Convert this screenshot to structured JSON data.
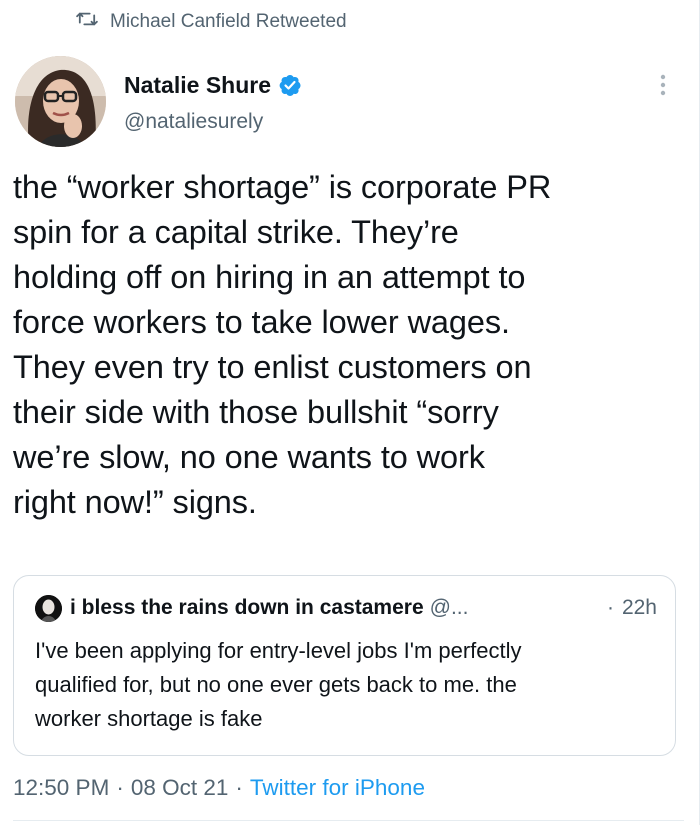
{
  "social_context": {
    "icon": "retweet-icon",
    "text": "Michael Canfield Retweeted"
  },
  "author": {
    "name": "Natalie Shure",
    "handle": "@nataliesurely",
    "verified": true,
    "verified_icon": "verified-badge-icon",
    "avatar": "profile-photo"
  },
  "more_icon": "more-vertical-icon",
  "tweet": {
    "text": "the “worker shortage” is corporate PR\nspin for a capital strike. They’re\nholding off on hiring in an attempt to\nforce workers to take lower wages.\nThey even try to enlist customers on\ntheir side with those bullshit “sorry\nwe’re slow, no one wants to work\nright now!” signs."
  },
  "quoted_tweet": {
    "author_name": "i bless the rains down in castamere",
    "handle": "@...",
    "separator": "·",
    "time": "22h",
    "text": "I've been applying for entry-level jobs I'm perfectly\nqualified for, but no one ever gets back to me. the\nworker shortage is fake"
  },
  "meta": {
    "time": "12:50 PM",
    "separator": "·",
    "date": "08 Oct 21",
    "source": "Twitter for iPhone"
  },
  "colors": {
    "text": "#0f1419",
    "secondary": "#536471",
    "link": "#1d9bf0",
    "border": "#d6dde3"
  }
}
